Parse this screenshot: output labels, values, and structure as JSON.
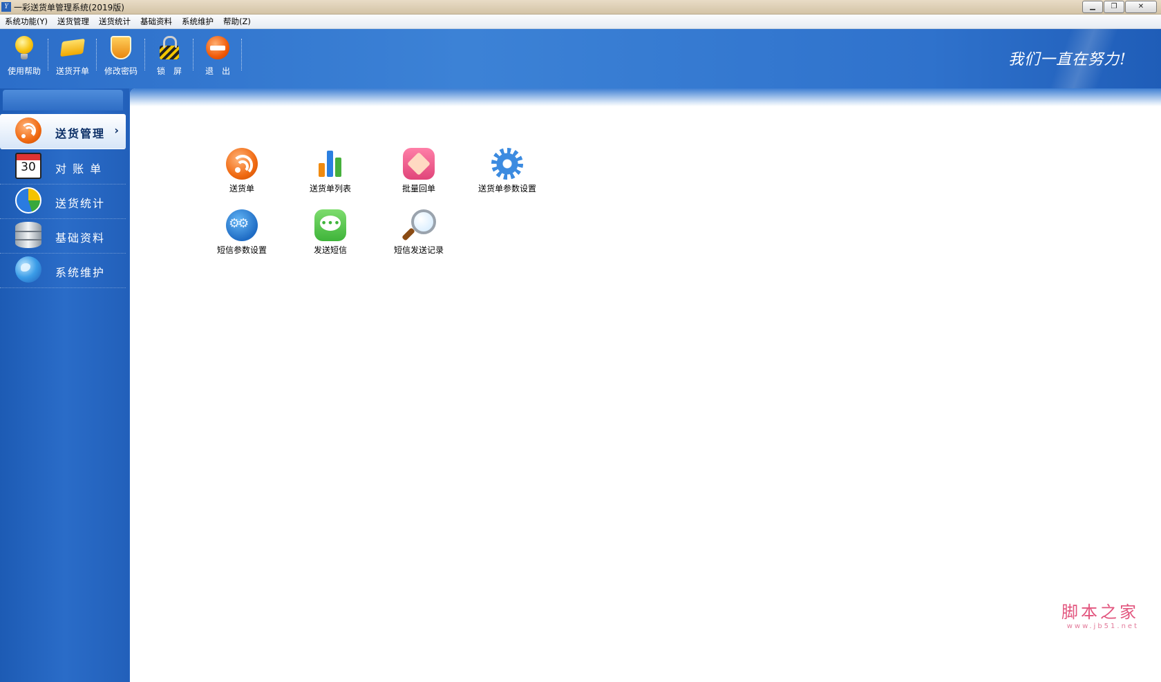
{
  "window": {
    "title": "一彩送货单管理系统(2019版)"
  },
  "menu": [
    {
      "label": "系统功能(Y)"
    },
    {
      "label": "送货管理"
    },
    {
      "label": "送货统计"
    },
    {
      "label": "基础资料"
    },
    {
      "label": "系统维护"
    },
    {
      "label": "帮助(Z)"
    }
  ],
  "toolbar": [
    {
      "label": "使用帮助",
      "icon": "lightbulb-icon"
    },
    {
      "label": "送货开单",
      "icon": "tag-icon"
    },
    {
      "label": "修改密码",
      "icon": "shield-icon"
    },
    {
      "label": "锁　屏",
      "icon": "lock-icon"
    },
    {
      "label": "退　出",
      "icon": "exit-icon"
    }
  ],
  "header": {
    "slogan": "我们一直在努力!"
  },
  "sidebar": {
    "items": [
      {
        "label": "送货管理",
        "icon": "rss-icon",
        "active": true
      },
      {
        "label": "对 账 单",
        "icon": "calendar-icon",
        "icon_text": "30"
      },
      {
        "label": "送货统计",
        "icon": "pie-chart-icon"
      },
      {
        "label": "基础资料",
        "icon": "database-icon"
      },
      {
        "label": "系统维护",
        "icon": "globe-icon"
      }
    ]
  },
  "main": {
    "items": [
      {
        "label": "送货单",
        "icon": "rss-icon"
      },
      {
        "label": "送货单列表",
        "icon": "bar-chart-icon"
      },
      {
        "label": "批量回单",
        "icon": "batch-receipt-icon"
      },
      {
        "label": "送货单参数设置",
        "icon": "gear-icon"
      },
      {
        "label": "短信参数设置",
        "icon": "gears-icon"
      },
      {
        "label": "发送短信",
        "icon": "chat-icon"
      },
      {
        "label": "短信发送记录",
        "icon": "magnifier-icon"
      }
    ]
  },
  "watermark": {
    "main": "脚本之家",
    "sub": "www.jb51.net"
  }
}
